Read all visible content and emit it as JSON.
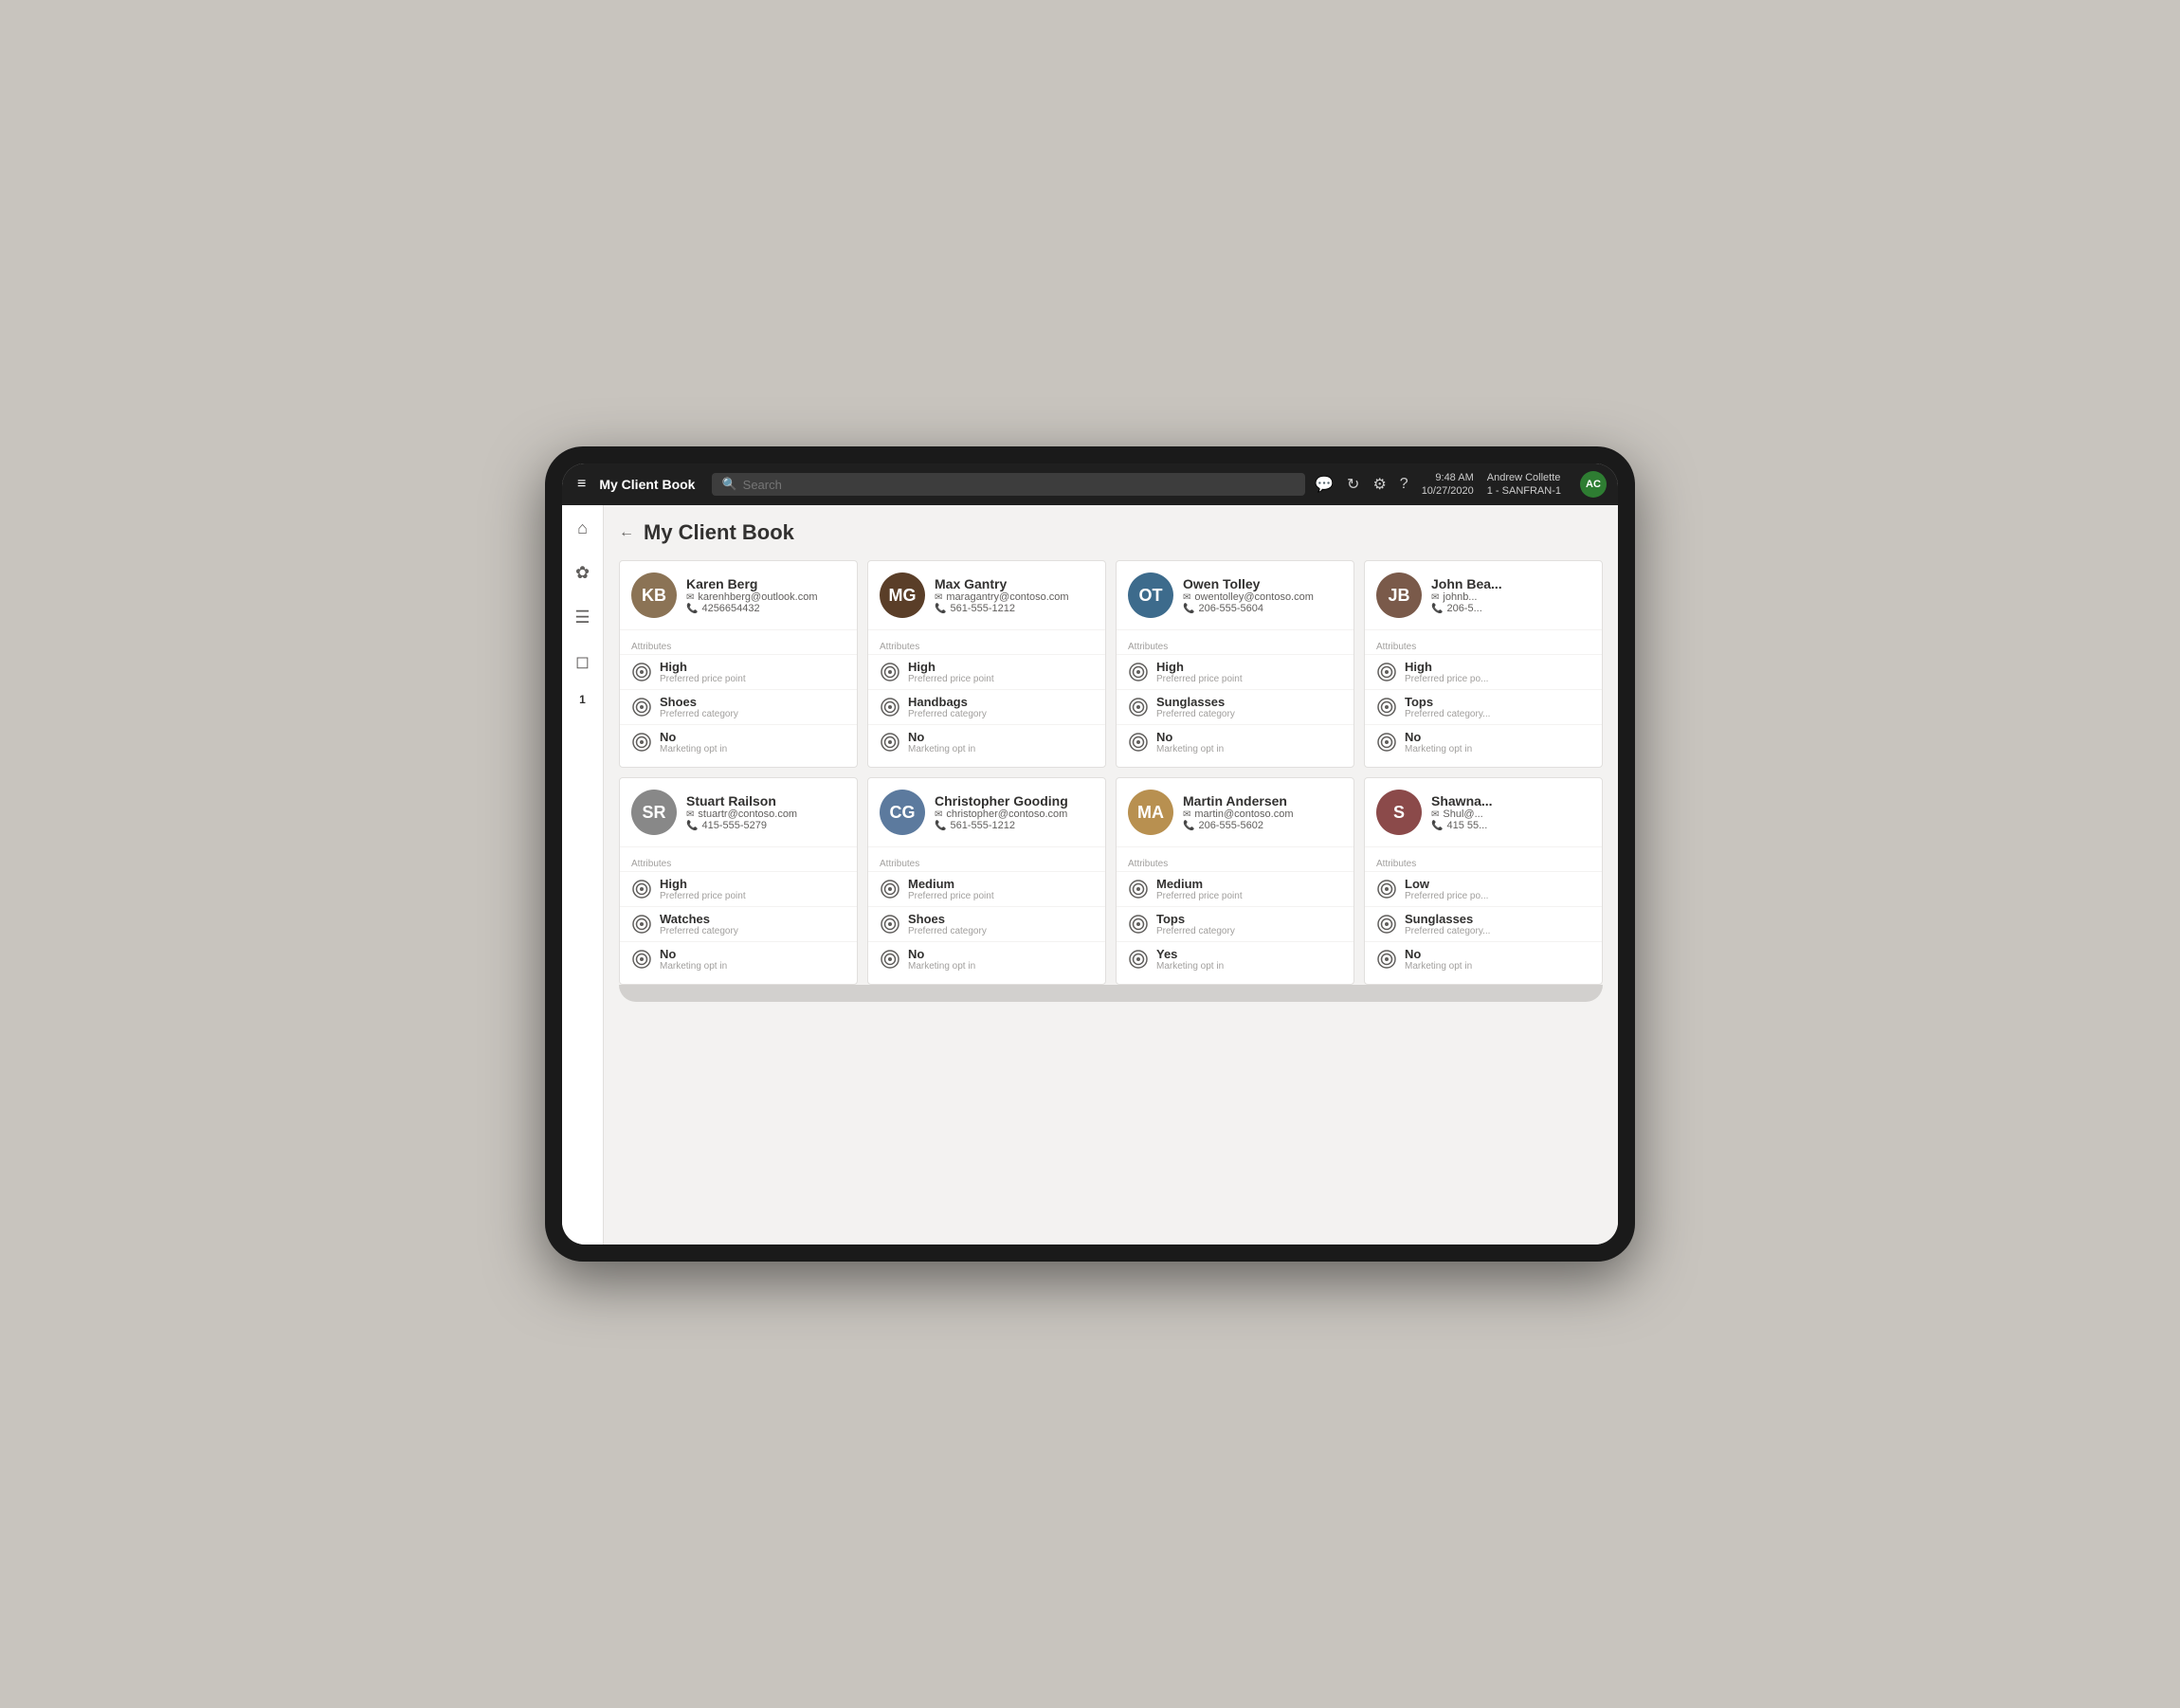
{
  "topNav": {
    "hamburger": "≡",
    "title": "My Client Book",
    "searchPlaceholder": "Search",
    "time": "9:48 AM",
    "date": "10/27/2020",
    "store": "1 - SANFRAN-1",
    "userName": "Andrew Collette",
    "userInitials": "AC",
    "icons": {
      "chat": "💬",
      "refresh": "↻",
      "settings": "⚙",
      "help": "?"
    }
  },
  "sidebar": {
    "items": [
      {
        "name": "home",
        "icon": "⌂",
        "active": false
      },
      {
        "name": "clients",
        "icon": "❋",
        "active": false
      },
      {
        "name": "tasks",
        "icon": "≡",
        "active": false
      },
      {
        "name": "bag",
        "icon": "🛍",
        "active": false
      },
      {
        "name": "badge",
        "label": "1",
        "active": false
      }
    ]
  },
  "page": {
    "backLabel": "←",
    "title": "My Client Book"
  },
  "clients": [
    {
      "id": 1,
      "name": "Karen Berg",
      "email": "karenhberg@outlook.com",
      "phone": "4256654432",
      "avatarInitials": "KB",
      "avatarClass": "av-karen",
      "attributes": [
        {
          "value": "High",
          "desc": "Preferred price point"
        },
        {
          "value": "Shoes",
          "desc": "Preferred category"
        },
        {
          "value": "No",
          "desc": "Marketing opt in"
        }
      ]
    },
    {
      "id": 2,
      "name": "Max Gantry",
      "email": "maragantry@contoso.com",
      "phone": "561-555-1212",
      "avatarInitials": "MG",
      "avatarClass": "av-max",
      "attributes": [
        {
          "value": "High",
          "desc": "Preferred price point"
        },
        {
          "value": "Handbags",
          "desc": "Preferred category"
        },
        {
          "value": "No",
          "desc": "Marketing opt in"
        }
      ]
    },
    {
      "id": 3,
      "name": "Owen Tolley",
      "email": "owentolley@contoso.com",
      "phone": "206-555-5604",
      "avatarInitials": "OT",
      "avatarClass": "av-owen",
      "attributes": [
        {
          "value": "High",
          "desc": "Preferred price point"
        },
        {
          "value": "Sunglasses",
          "desc": "Preferred category"
        },
        {
          "value": "No",
          "desc": "Marketing opt in"
        }
      ]
    },
    {
      "id": 4,
      "name": "John Bea...",
      "email": "johnb...",
      "phone": "206-5...",
      "avatarInitials": "JB",
      "avatarClass": "av-john",
      "attributes": [
        {
          "value": "High",
          "desc": "Preferred price po..."
        },
        {
          "value": "Tops",
          "desc": "Preferred category..."
        },
        {
          "value": "No",
          "desc": "Marketing opt in"
        }
      ]
    },
    {
      "id": 5,
      "name": "Stuart Railson",
      "email": "stuartr@contoso.com",
      "phone": "415-555-5279",
      "avatarInitials": "SR",
      "avatarClass": "av-stuart",
      "attributes": [
        {
          "value": "High",
          "desc": "Preferred price point"
        },
        {
          "value": "Watches",
          "desc": "Preferred category"
        },
        {
          "value": "No",
          "desc": "Marketing opt in"
        }
      ]
    },
    {
      "id": 6,
      "name": "Christopher Gooding",
      "email": "christopher@contoso.com",
      "phone": "561-555-1212",
      "avatarInitials": "CG",
      "avatarClass": "av-christopher",
      "attributes": [
        {
          "value": "Medium",
          "desc": "Preferred price point"
        },
        {
          "value": "Shoes",
          "desc": "Preferred category"
        },
        {
          "value": "No",
          "desc": "Marketing opt in"
        }
      ]
    },
    {
      "id": 7,
      "name": "Martin Andersen",
      "email": "martin@contoso.com",
      "phone": "206-555-5602",
      "avatarInitials": "MA",
      "avatarClass": "av-martin",
      "attributes": [
        {
          "value": "Medium",
          "desc": "Preferred price point"
        },
        {
          "value": "Tops",
          "desc": "Preferred category"
        },
        {
          "value": "Yes",
          "desc": "Marketing opt in"
        }
      ]
    },
    {
      "id": 8,
      "name": "Shawna...",
      "email": "Shul@...",
      "phone": "415 55...",
      "avatarInitials": "S",
      "avatarClass": "av-shawna",
      "attributes": [
        {
          "value": "Low",
          "desc": "Preferred price po..."
        },
        {
          "value": "Sunglasses",
          "desc": "Preferred category..."
        },
        {
          "value": "No",
          "desc": "Marketing opt in"
        }
      ]
    }
  ],
  "labels": {
    "attributes": "Attributes"
  }
}
